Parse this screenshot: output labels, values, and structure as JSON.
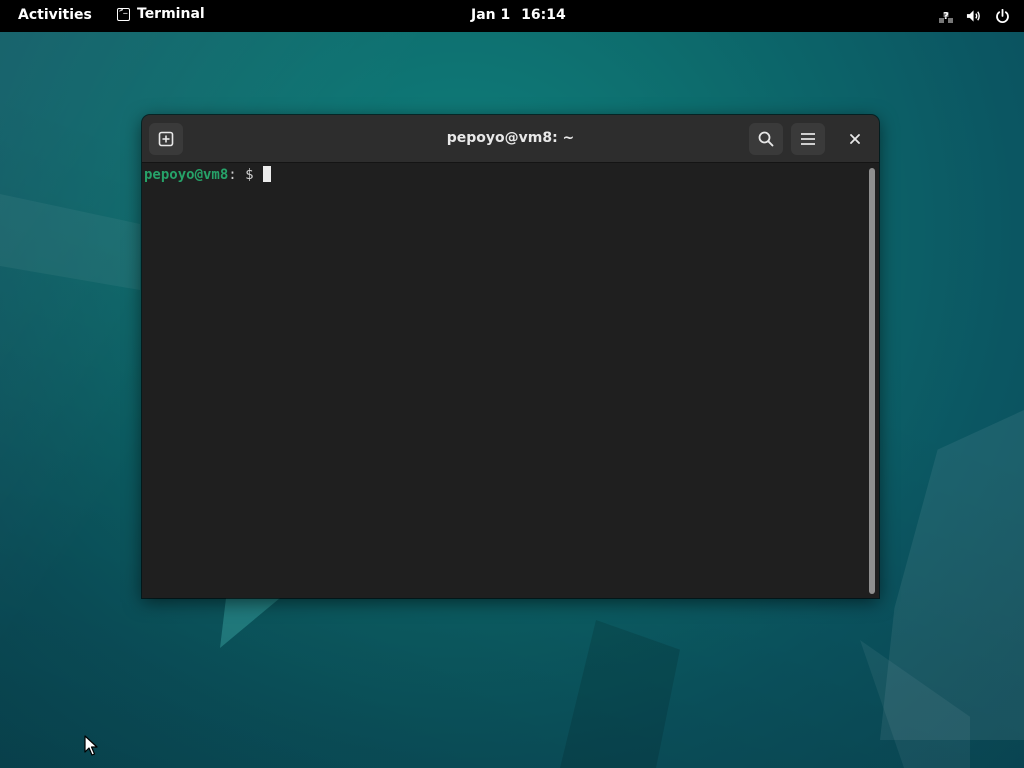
{
  "topbar": {
    "activities_label": "Activities",
    "app_name": "Terminal",
    "app_icon": "terminal-icon",
    "clock_date": "Jan 1",
    "clock_time": "16:14",
    "tray_icons": [
      "network-unknown-icon",
      "volume-icon",
      "power-icon"
    ]
  },
  "window": {
    "title": "pepoyo@vm8: ~",
    "header_buttons": [
      "new-tab-icon",
      "search-icon",
      "hamburger-menu-icon",
      "close-icon"
    ],
    "terminal": {
      "prompt_user_host": "pepoyo@vm8",
      "prompt_separator": ":",
      "prompt_path": "",
      "prompt_symbol": " $ ",
      "input_text": ""
    }
  },
  "colors": {
    "topbar_bg": "#000000",
    "headerbar_bg": "#2d2d2d",
    "terminal_bg": "#1f1f1f",
    "prompt_user_color": "#26a269",
    "desktop_accent": "#0d6c6d"
  }
}
